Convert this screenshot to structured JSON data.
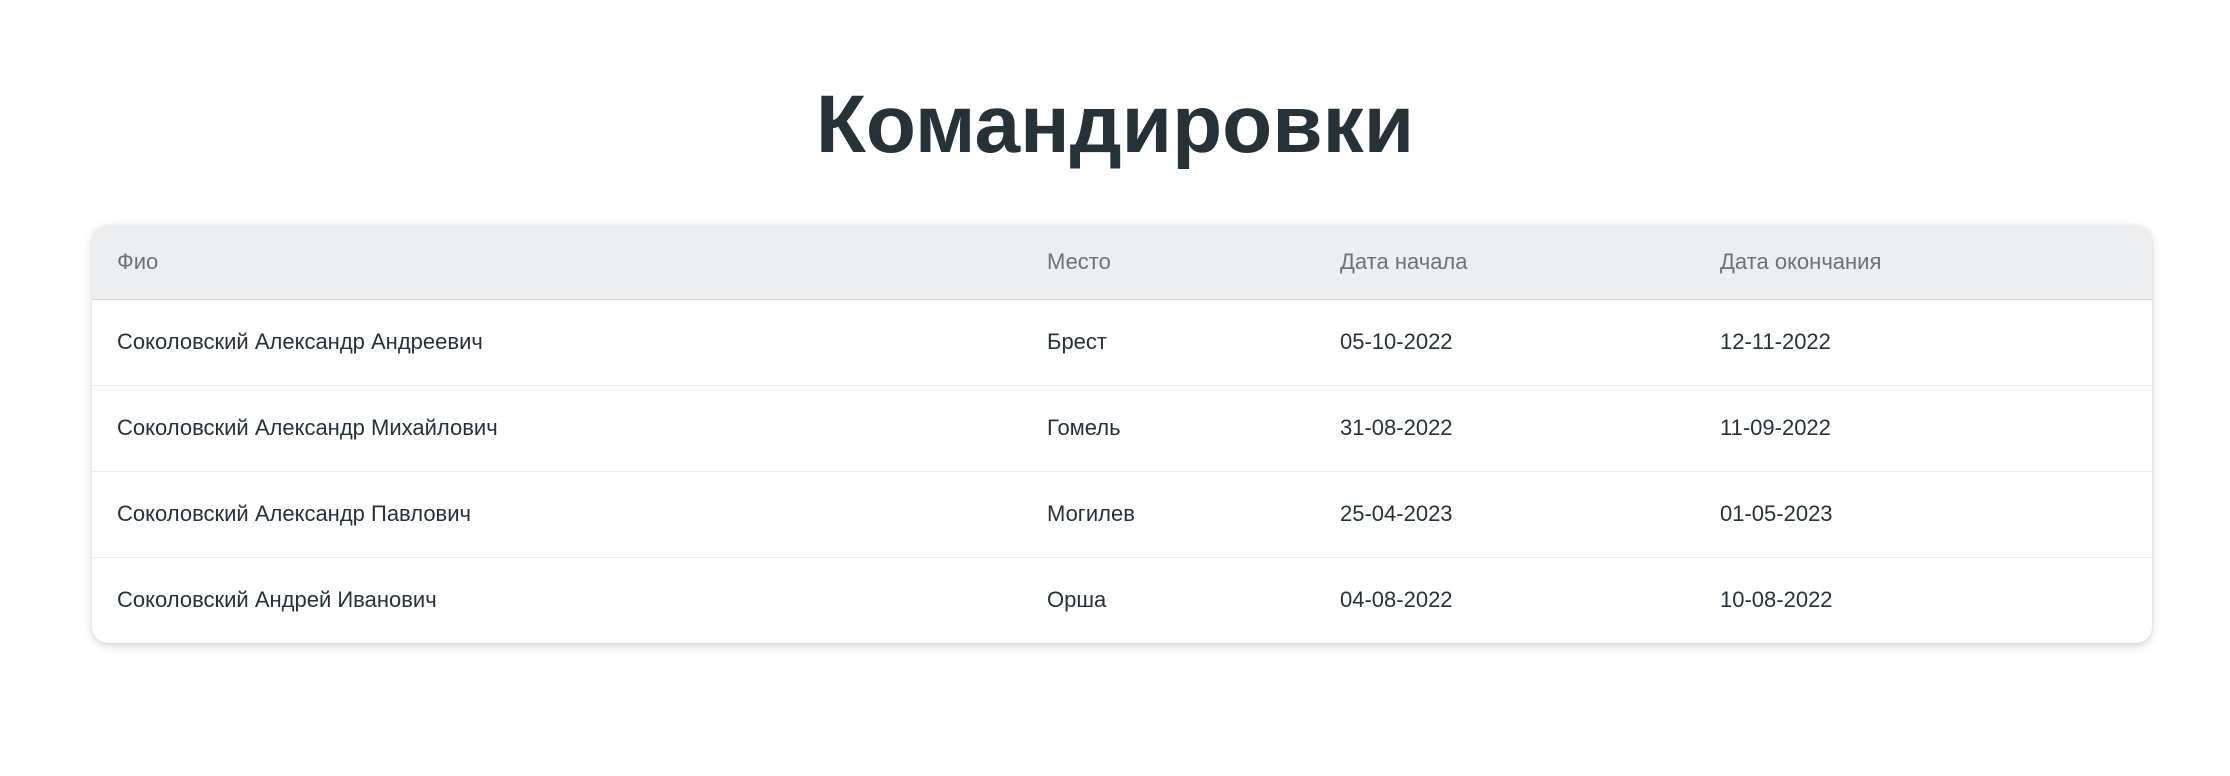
{
  "page": {
    "title": "Командировки"
  },
  "table": {
    "headers": {
      "name": "Фио",
      "place": "Место",
      "start": "Дата начала",
      "end": "Дата окончания"
    },
    "rows": [
      {
        "name": "Соколовский Александр Андреевич",
        "place": "Брест",
        "start": "05-10-2022",
        "end": "12-11-2022"
      },
      {
        "name": "Соколовский Александр Михайлович",
        "place": "Гомель",
        "start": "31-08-2022",
        "end": "11-09-2022"
      },
      {
        "name": "Соколовский Александр Павлович",
        "place": "Могилев",
        "start": "25-04-2023",
        "end": "01-05-2023"
      },
      {
        "name": "Соколовский Андрей Иванович",
        "place": "Орша",
        "start": "04-08-2022",
        "end": "10-08-2022"
      }
    ]
  },
  "colors": {
    "text": "#263238",
    "header_bg": "#eceef0",
    "header_text": "#6b7378"
  }
}
